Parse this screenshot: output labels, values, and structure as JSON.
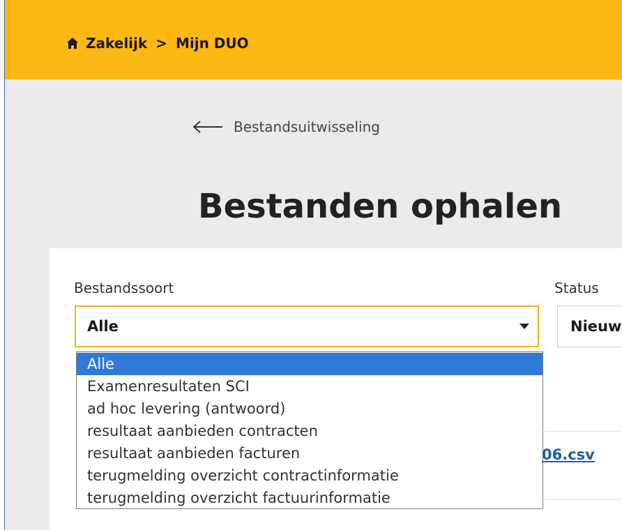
{
  "breadcrumb": {
    "home_label": "Zakelijk",
    "separator": ">",
    "current_label": "Mijn DUO"
  },
  "back_link": {
    "label": "Bestandsuitwisseling"
  },
  "page_title": "Bestanden ophalen",
  "filters": {
    "type_label": "Bestandssoort",
    "type_value": "Alle",
    "status_label": "Status",
    "status_value": "Nieuw"
  },
  "dropdown_options": [
    "Alle",
    "Examenresultaten SCI",
    "ad hoc levering (antwoord)",
    "resultaat aanbieden contracten",
    "resultaat aanbieden facturen",
    "terugmelding overzicht contractinformatie",
    "terugmelding overzicht factuurinformatie"
  ],
  "file_link_fragment": "06.csv",
  "colors": {
    "header_bg": "#fdb813",
    "page_bg": "#ebebeb",
    "select_border": "#f3b21f",
    "selected_option_bg": "#2f7ad8",
    "link": "#1d5eb0"
  }
}
